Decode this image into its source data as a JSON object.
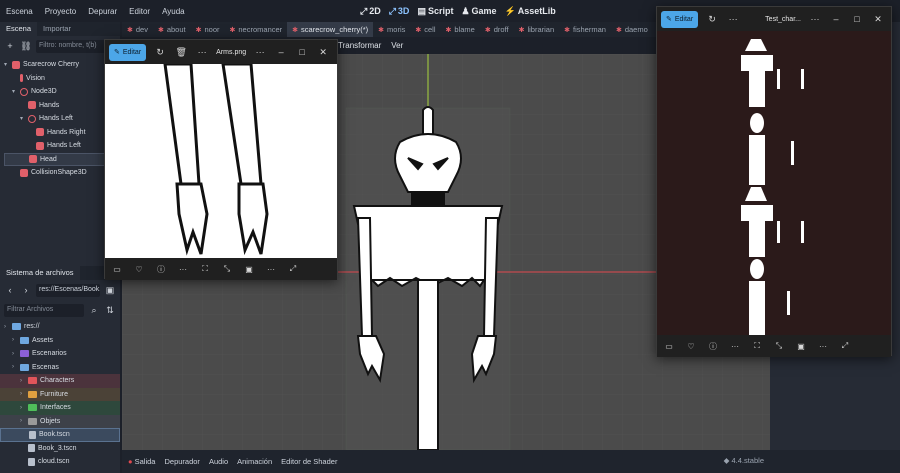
{
  "menubar": {
    "items": [
      "Escena",
      "Proyecto",
      "Depurar",
      "Editor",
      "Ayuda"
    ],
    "modes": [
      {
        "label": "2D",
        "icon": "2d-icon"
      },
      {
        "label": "3D",
        "icon": "3d-icon"
      },
      {
        "label": "Script",
        "icon": "script-icon"
      },
      {
        "label": "Game",
        "icon": "game-icon"
      },
      {
        "label": "AssetLib",
        "icon": "assetlib-icon"
      }
    ]
  },
  "scene_dock": {
    "tabs": [
      "Escena",
      "Importar"
    ],
    "filter_placeholder": "Filtro: nombre, t(b)",
    "tree": [
      {
        "label": "Scarecrow Cherry",
        "depth": 0,
        "icon": "node3d",
        "color": "#e0606a"
      },
      {
        "label": "Vision",
        "depth": 1,
        "icon": "marker",
        "color": "#e0606a"
      },
      {
        "label": "Node3D",
        "depth": 1,
        "icon": "circle",
        "color": "#e0606a"
      },
      {
        "label": "Hands",
        "depth": 2,
        "icon": "sprite",
        "color": "#e0606a"
      },
      {
        "label": "Hands Left",
        "depth": 2,
        "icon": "circle",
        "color": "#e0606a"
      },
      {
        "label": "Hands Right",
        "depth": 3,
        "icon": "sprite",
        "color": "#e0606a"
      },
      {
        "label": "Hands Left",
        "depth": 3,
        "icon": "sprite",
        "color": "#e0606a"
      },
      {
        "label": "Head",
        "depth": 2,
        "icon": "sprite",
        "color": "#e0606a",
        "selected": true
      },
      {
        "label": "CollisionShape3D",
        "depth": 1,
        "icon": "sprite",
        "color": "#e0606a"
      }
    ]
  },
  "fs_dock": {
    "title": "Sistema de archivos",
    "path": "res://Escenas/Book.tsc",
    "filter_placeholder": "Filtrar Archivos",
    "items": [
      {
        "label": "res://",
        "depth": 0,
        "type": "folder",
        "color": "#6fa8e0"
      },
      {
        "label": "Assets",
        "depth": 1,
        "type": "folder",
        "color": "#6fa8e0"
      },
      {
        "label": "Escenarios",
        "depth": 1,
        "type": "folder",
        "color": "#8a5fd6"
      },
      {
        "label": "Escenas",
        "depth": 1,
        "type": "folder",
        "color": "#6fa8e0"
      },
      {
        "label": "Characters",
        "depth": 2,
        "type": "folder",
        "color": "#e0555a"
      },
      {
        "label": "Furniture",
        "depth": 2,
        "type": "folder",
        "color": "#e0a040"
      },
      {
        "label": "Interfaces",
        "depth": 2,
        "type": "folder",
        "color": "#4fbf5a"
      },
      {
        "label": "Objets",
        "depth": 2,
        "type": "folder",
        "color": "#9a9a9a"
      },
      {
        "label": "Book.tscn",
        "depth": 2,
        "type": "file",
        "selected": true
      },
      {
        "label": "Book_3.tscn",
        "depth": 2,
        "type": "file"
      },
      {
        "label": "cloud.tscn",
        "depth": 2,
        "type": "file"
      }
    ]
  },
  "scene_tabs": [
    {
      "label": "dev",
      "active": false
    },
    {
      "label": "about",
      "active": false
    },
    {
      "label": "noor",
      "active": false
    },
    {
      "label": "necromancer",
      "active": false
    },
    {
      "label": "scarecrow_cherry(*)",
      "active": true
    },
    {
      "label": "moris",
      "active": false
    },
    {
      "label": "cell",
      "active": false
    },
    {
      "label": "blame",
      "active": false
    },
    {
      "label": "droff",
      "active": false
    },
    {
      "label": "librarian",
      "active": false
    },
    {
      "label": "fisherman",
      "active": false
    },
    {
      "label": "daemo",
      "active": false
    }
  ],
  "viewport_menu": [
    "Transformar",
    "Ver"
  ],
  "bottombar": {
    "items": [
      "Salida",
      "Depurador",
      "Audio",
      "Animación",
      "Editor de Shader"
    ],
    "version": "4.4.stable"
  },
  "viewer_arms": {
    "edit_label": "Editar",
    "title": "Arms.png"
  },
  "viewer_test": {
    "edit_label": "Editar",
    "title": "Test_char..."
  },
  "colors": {
    "accent": "#4ca6e8",
    "node_red": "#e0606a",
    "viewport_bg": "#4b4b4b",
    "sprite_sheet_bg": "#2b1a1a"
  }
}
